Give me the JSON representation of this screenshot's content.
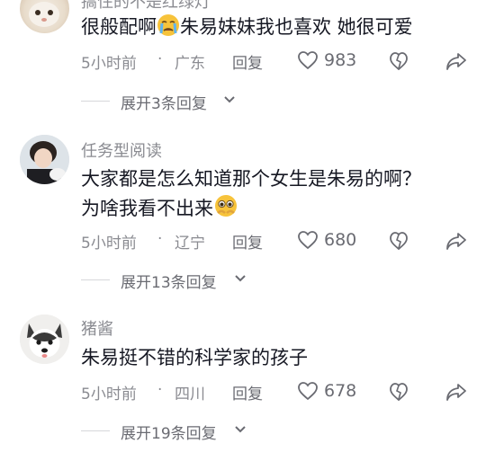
{
  "comments": [
    {
      "username": "搞住的不是红绿灯",
      "text_before": "很般配啊",
      "text_after": "朱易妹妹我也喜欢 她很可爱",
      "emoji": "crying-face-emoji",
      "time": "5小时前",
      "dot": "·",
      "location": "广东",
      "reply_label": "回复",
      "likes": "983",
      "expand_label": "展开3条回复"
    },
    {
      "username": "任务型阅读",
      "text_line1": "大家都是怎么知道那个女生是朱易的啊？",
      "text_line2": "为啥我看不出来",
      "emoji": "pleading-face-emoji",
      "time": "5小时前",
      "dot": "·",
      "location": "辽宁",
      "reply_label": "回复",
      "likes": "680",
      "expand_label": "展开13条回复"
    },
    {
      "username": "猪酱",
      "text": "朱易挺不错的科学家的孩子",
      "time": "5小时前",
      "dot": "·",
      "location": "四川",
      "reply_label": "回复",
      "likes": "678",
      "expand_label": "展开19条回复"
    }
  ],
  "colors": {
    "secondary_text": "#8a8b91",
    "primary_text": "#161823"
  }
}
